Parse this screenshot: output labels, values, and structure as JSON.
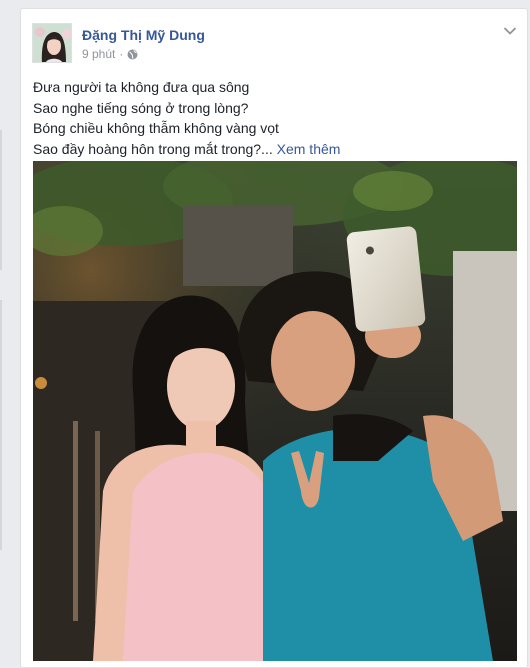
{
  "post": {
    "author": "Đặng Thị Mỹ Dung",
    "time": "9 phút",
    "separator": "·",
    "visibility_icon": "globe-icon",
    "menu_icon": "chevron-down-icon",
    "lines": [
      "Đưa người ta không đưa qua sông",
      "Sao nghe tiếng sóng ở trong lòng?",
      "Bóng chiều không thẫm không vàng vọt",
      "Sao đầy hoàng hôn trong mắt trong?..."
    ],
    "see_more": "Xem thêm"
  },
  "colors": {
    "link": "#365899",
    "text": "#1d2129",
    "meta": "#90949c",
    "page_bg": "#e9ebee"
  }
}
